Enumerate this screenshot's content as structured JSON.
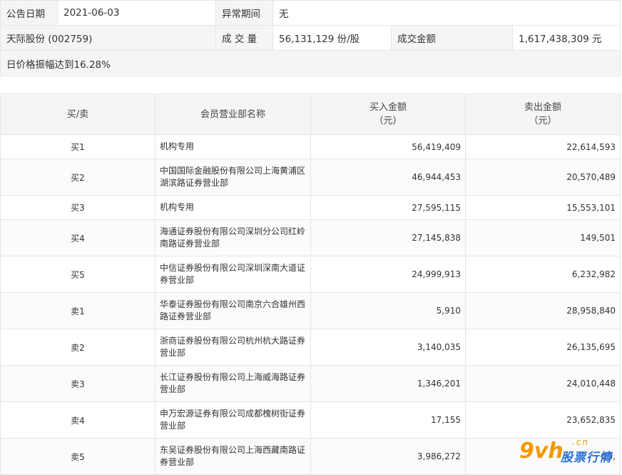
{
  "info": {
    "announce_date_label": "公告日期",
    "announce_date": "2021-06-03",
    "abnormal_period_label": "异常期间",
    "abnormal_period": "无",
    "stock": "天际股份 (002759)",
    "volume_label": "成 交 量",
    "volume": "56,131,129 份/股",
    "amount_label": "成交金额",
    "amount": "1,617,438,309 元",
    "reason": "日价格振幅达到16.28%"
  },
  "table": {
    "headers": [
      "买/卖",
      "会员营业部名称",
      "买入金额",
      "（元）",
      "卖出金额",
      "（元）"
    ],
    "rows": [
      {
        "side": "买1",
        "name1": "机构专用",
        "name2": "",
        "buy": "56,419,409",
        "sell": "22,614,593"
      },
      {
        "side": "买2",
        "name1": "中国国际金融股份有限公司上海黄浦区",
        "name2": "湖滨路证券营业部",
        "buy": "46,944,453",
        "sell": "20,570,489"
      },
      {
        "side": "买3",
        "name1": "机构专用",
        "name2": "",
        "buy": "27,595,115",
        "sell": "15,553,101"
      },
      {
        "side": "买4",
        "name1": "海通证券股份有限公司深圳分公司红岭",
        "name2": "南路证券营业部",
        "buy": "27,145,838",
        "sell": "149,501"
      },
      {
        "side": "买5",
        "name1": "中信证券股份有限公司深圳深南大道证",
        "name2": "券营业部",
        "buy": "24,999,913",
        "sell": "6,232,982"
      },
      {
        "side": "卖1",
        "name1": "华泰证券股份有限公司南京六合雄州西",
        "name2": "路证券营业部",
        "buy": "5,910",
        "sell": "28,958,840"
      },
      {
        "side": "卖2",
        "name1": "浙商证券股份有限公司杭州杭大路证券",
        "name2": "营业部",
        "buy": "3,140,035",
        "sell": "26,135,695"
      },
      {
        "side": "卖3",
        "name1": "长江证券股份有限公司上海威海路证券",
        "name2": "营业部",
        "buy": "1,346,201",
        "sell": "24,010,448"
      },
      {
        "side": "卖4",
        "name1": "申万宏源证券有限公司成都槐树街证券",
        "name2": "营业部",
        "buy": "17,155",
        "sell": "23,652,835"
      },
      {
        "side": "卖5",
        "name1": "东吴证券股份有限公司上海西藏南路证",
        "name2": "券营业部",
        "buy": "3,986,272",
        "sell": "23,"
      }
    ]
  },
  "watermark": {
    "logo": "9vh",
    "domain": ".cn",
    "text": "股票行情",
    "orange": "#f39800",
    "blue": "#2a6fd6"
  }
}
